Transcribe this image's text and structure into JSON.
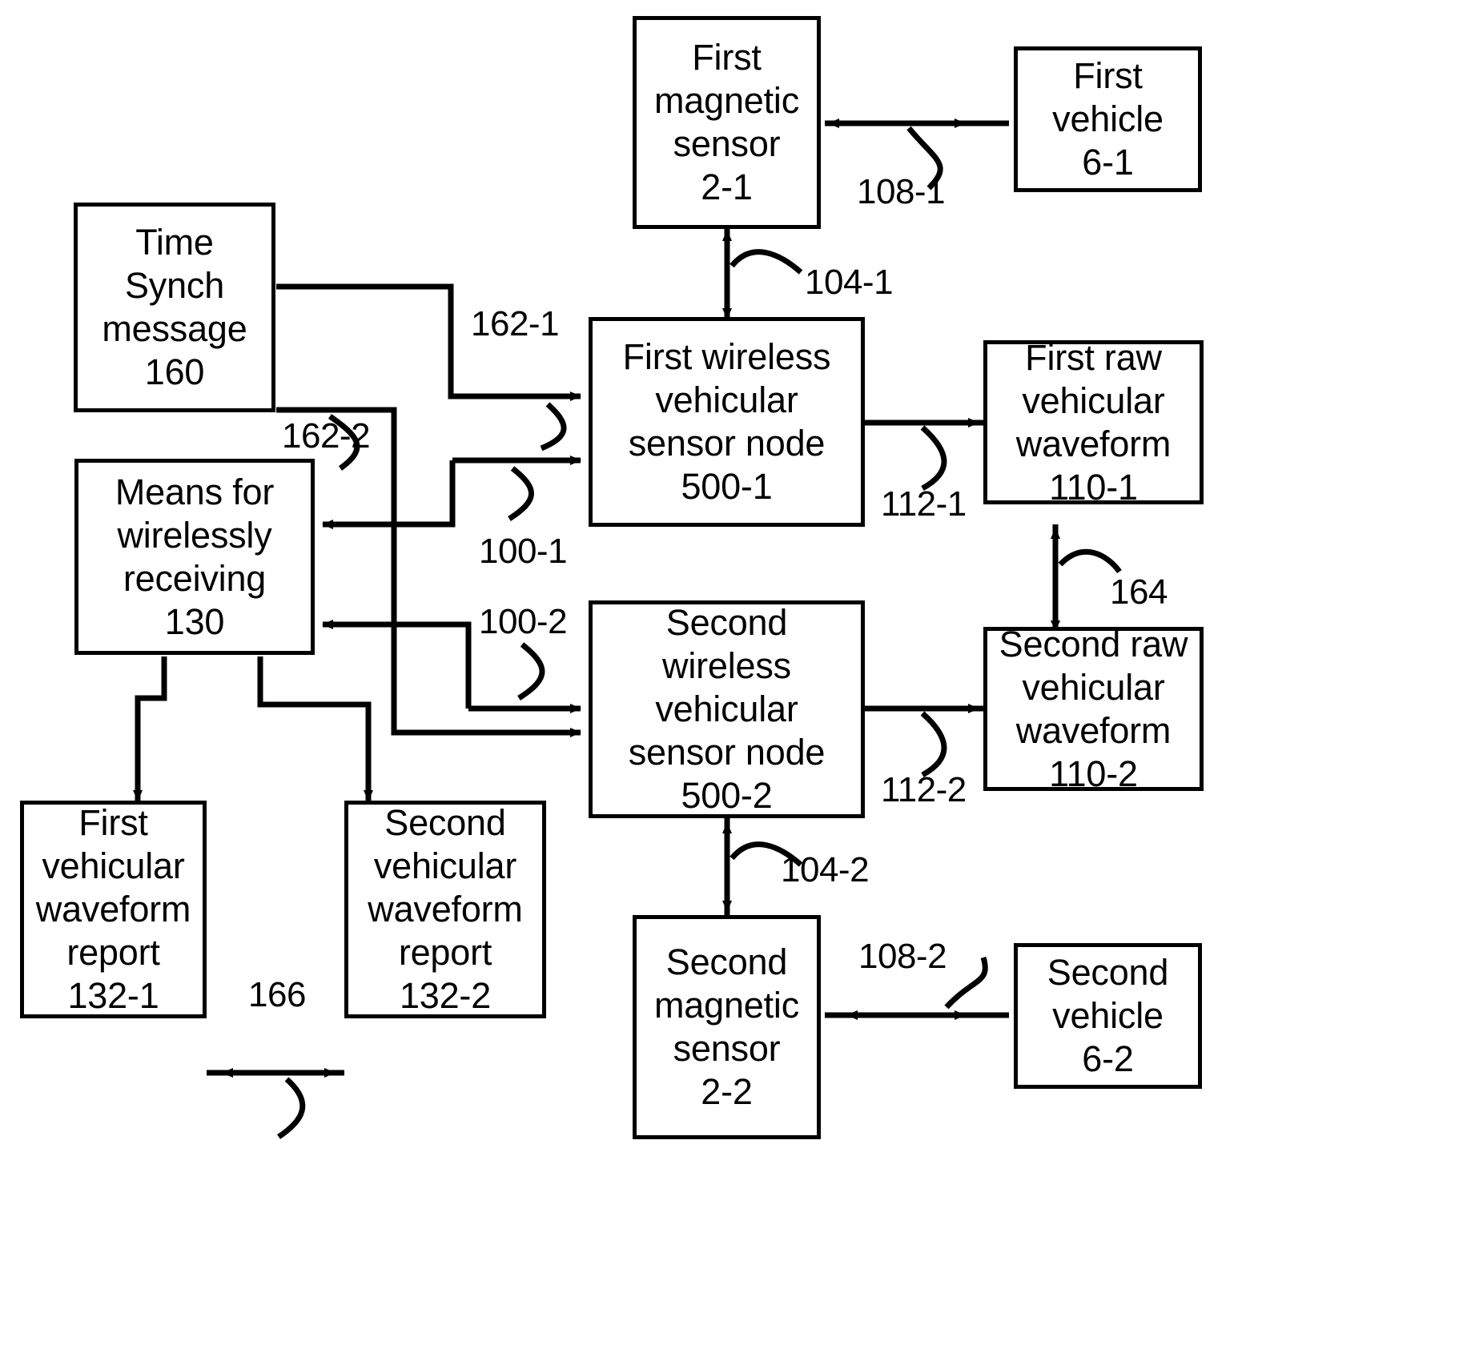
{
  "diagram": {
    "title": "Wireless vehicular sensor node block diagram",
    "stroke_color": "#000000",
    "background_color": "#ffffff",
    "boxes": [
      {
        "id": "first-magnetic-sensor",
        "lines": [
          "First",
          "magnetic",
          "sensor",
          "2-1"
        ],
        "ref": "2-1"
      },
      {
        "id": "first-vehicle",
        "lines": [
          "First",
          "vehicle",
          "6-1"
        ],
        "ref": "6-1"
      },
      {
        "id": "time-synch-message",
        "lines": [
          "Time",
          "Synch",
          "message",
          "160"
        ],
        "ref": "160"
      },
      {
        "id": "first-wireless-vehicular-sensor-node",
        "lines": [
          "First wireless",
          "vehicular",
          "sensor node",
          "500-1"
        ],
        "ref": "500-1"
      },
      {
        "id": "first-raw-vehicular-waveform",
        "lines": [
          "First raw",
          "vehicular",
          "waveform",
          "110-1"
        ],
        "ref": "110-1"
      },
      {
        "id": "means-for-wirelessly-receiving",
        "lines": [
          "Means for",
          "wirelessly",
          "receiving",
          "130"
        ],
        "ref": "130"
      },
      {
        "id": "second-wireless-vehicular-sensor-node",
        "lines": [
          "Second",
          "wireless",
          "vehicular",
          "sensor node",
          "500-2"
        ],
        "ref": "500-2"
      },
      {
        "id": "second-raw-vehicular-waveform",
        "lines": [
          "Second raw",
          "vehicular",
          "waveform",
          "110-2"
        ],
        "ref": "110-2"
      },
      {
        "id": "first-vehicular-waveform-report",
        "lines": [
          "First",
          "vehicular",
          "waveform",
          "report",
          "132-1"
        ],
        "ref": "132-1"
      },
      {
        "id": "second-vehicular-waveform-report",
        "lines": [
          "Second",
          "vehicular",
          "waveform",
          "report",
          "132-2"
        ],
        "ref": "132-2"
      },
      {
        "id": "second-magnetic-sensor",
        "lines": [
          "Second",
          "magnetic",
          "sensor",
          "2-2"
        ],
        "ref": "2-2"
      },
      {
        "id": "second-vehicle",
        "lines": [
          "Second",
          "vehicle",
          "6-2"
        ],
        "ref": "6-2"
      }
    ],
    "connector_labels": [
      {
        "id": "108-1",
        "text": "108-1"
      },
      {
        "id": "104-1",
        "text": "104-1"
      },
      {
        "id": "162-1",
        "text": "162-1"
      },
      {
        "id": "162-2",
        "text": "162-2"
      },
      {
        "id": "100-1",
        "text": "100-1"
      },
      {
        "id": "112-1",
        "text": "112-1"
      },
      {
        "id": "164",
        "text": "164"
      },
      {
        "id": "100-2",
        "text": "100-2"
      },
      {
        "id": "112-2",
        "text": "112-2"
      },
      {
        "id": "104-2",
        "text": "104-2"
      },
      {
        "id": "108-2",
        "text": "108-2"
      },
      {
        "id": "166",
        "text": "166"
      }
    ]
  }
}
